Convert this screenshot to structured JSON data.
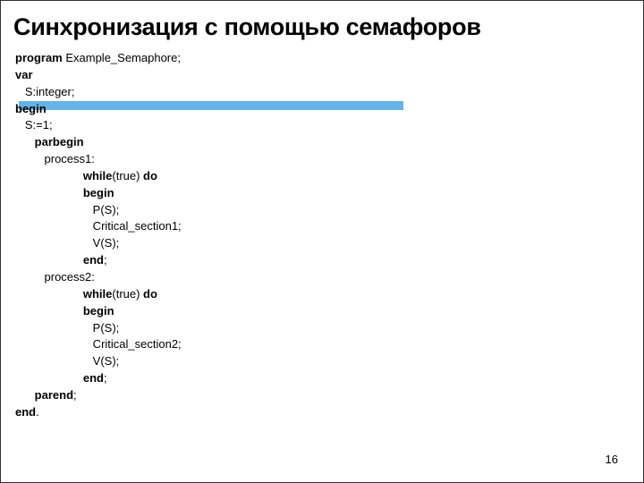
{
  "title": "Синхронизация с помощью семафоров",
  "pagenum": "16",
  "kw": {
    "program": "program",
    "var": "var",
    "begin": "begin",
    "parbegin": "parbegin",
    "while": "while",
    "do": "do",
    "end_sc": "end",
    "parend": "parend",
    "end_dot": "end"
  },
  "code": {
    "prog_name": " Example_Semaphore;",
    "decl": "   S:integer;",
    "assign": "   S:=1;",
    "proc1": "         process1:",
    "true_do": "(true) ",
    "ps": "                        P(S);",
    "cs1": "                        Critical_section1;",
    "vs": "                        V(S);",
    "proc2": "         process2:",
    "cs2": "                        Critical_section2;",
    "semi": ";",
    "dot": "."
  }
}
